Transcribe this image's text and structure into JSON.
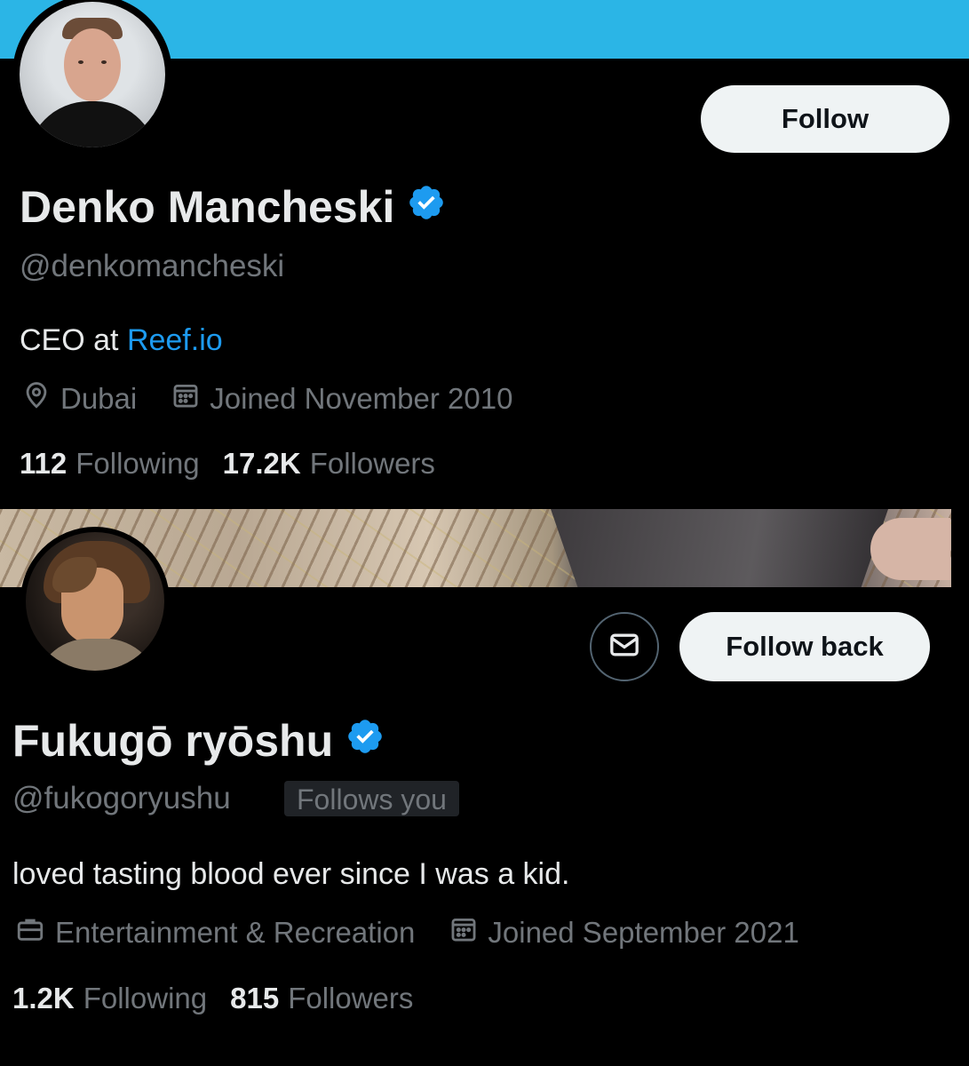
{
  "profiles": [
    {
      "name": "Denko Mancheski",
      "handle": "@denkomancheski",
      "bio_prefix": "CEO at ",
      "bio_link": "Reef.io",
      "location": "Dubai",
      "joined": "Joined November 2010",
      "following_count": "112",
      "following_label": "Following",
      "followers_count": "17.2K",
      "followers_label": "Followers",
      "button_label": "Follow",
      "banner_color": "#2bb5e6",
      "verified": true
    },
    {
      "name": "Fukugō ryōshu",
      "handle": "@fukogoryushu",
      "follows_you": "Follows you",
      "bio": "loved tasting blood ever since I was a kid.",
      "category": "Entertainment & Recreation",
      "joined": "Joined September 2021",
      "following_count": "1.2K",
      "following_label": "Following",
      "followers_count": "815",
      "followers_label": "Followers",
      "button_label": "Follow back",
      "verified": true
    }
  ],
  "colors": {
    "accent": "#1d9bf0",
    "muted": "#71767b",
    "text": "#e7e9ea",
    "background": "#000000",
    "button_bg": "#eff3f4"
  },
  "icons": [
    "location-icon",
    "calendar-icon",
    "briefcase-icon",
    "mail-icon",
    "verified-badge-icon"
  ]
}
